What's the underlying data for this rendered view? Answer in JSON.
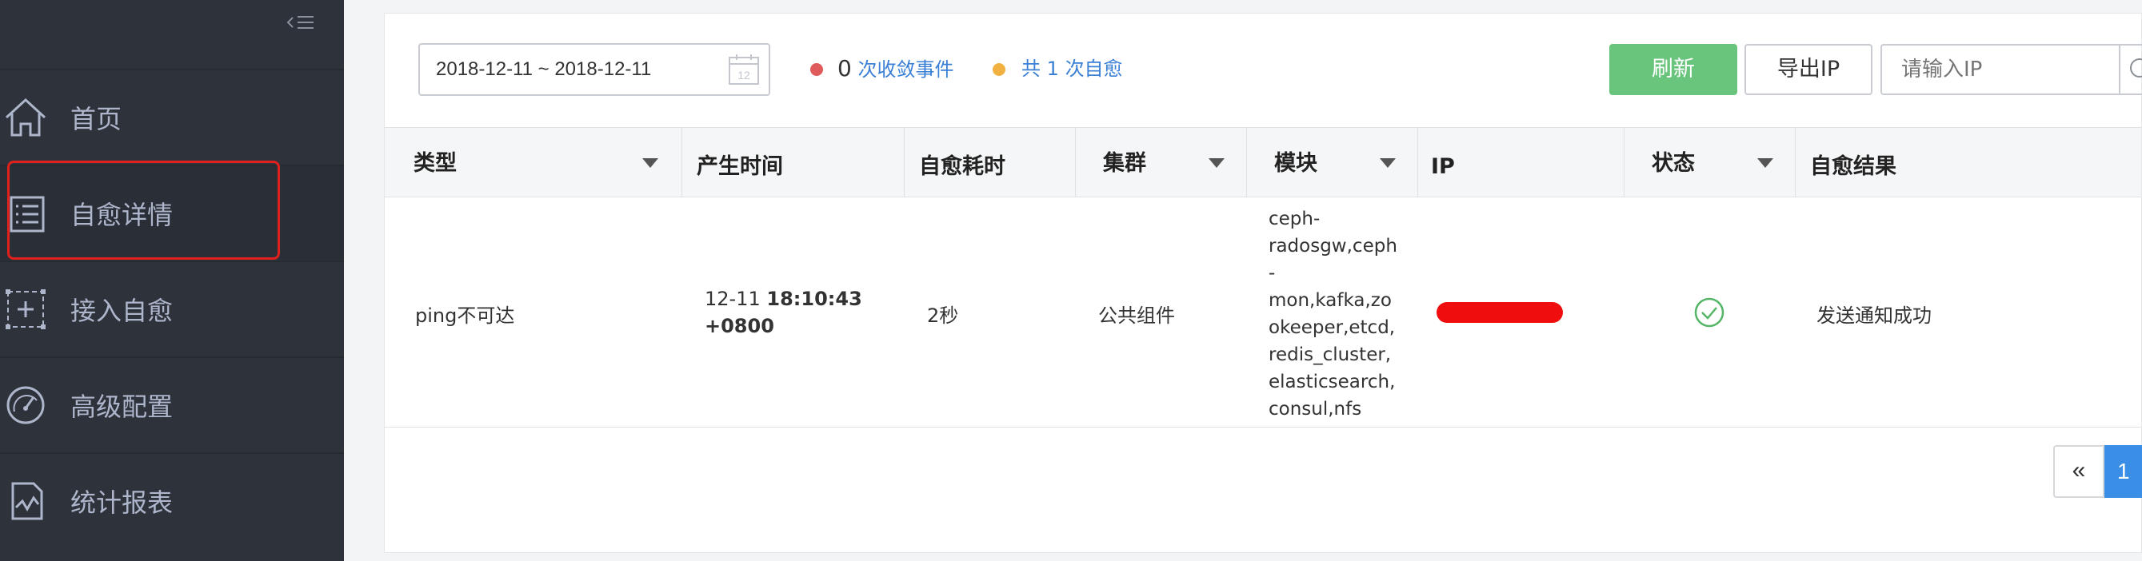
{
  "sidebar": {
    "collapse_glyph": "<☰",
    "items": [
      {
        "label": "首页",
        "icon": "home-icon"
      },
      {
        "label": "自愈详情",
        "icon": "list-icon"
      },
      {
        "label": "接入自愈",
        "icon": "add-frame-icon"
      },
      {
        "label": "高级配置",
        "icon": "gauge-icon"
      },
      {
        "label": "统计报表",
        "icon": "chart-icon"
      }
    ],
    "active_index": 1
  },
  "toolbar": {
    "date_range": "2018-12-11 ~ 2018-12-11",
    "stat1_count": "0",
    "stat1_label": "次收敛事件",
    "stat2_prefix": "共",
    "stat2_count": "1",
    "stat2_label": "次自愈",
    "refresh_label": "刷新",
    "export_label": "导出IP",
    "ip_placeholder": "请输入IP"
  },
  "table": {
    "headers": [
      "类型",
      "产生时间",
      "自愈耗时",
      "集群",
      "模块",
      "IP",
      "状态",
      "自愈结果"
    ],
    "row": {
      "type": "ping不可达",
      "time_date": "12-11 ",
      "time_clock": "18:10:43",
      "time_tz": "+0800",
      "duration": "2秒",
      "cluster": "公共组件",
      "module_lines": [
        "ceph-",
        "radosgw,ceph",
        "-",
        "mon,kafka,zo",
        "okeeper,etcd,",
        "redis_cluster,",
        "elasticsearch,",
        "consul,nfs"
      ],
      "status_icon": "check-circle-icon",
      "result": "发送通知成功"
    }
  },
  "pagination": {
    "prev": "«",
    "current": "1"
  },
  "colors": {
    "sidebar_bg": "#2e323b",
    "accent_green": "#69c57c",
    "accent_blue": "#3a8ee6",
    "red_dot": "#e05c5c",
    "yellow_dot": "#f0b140",
    "highlight": "#e0201c"
  }
}
